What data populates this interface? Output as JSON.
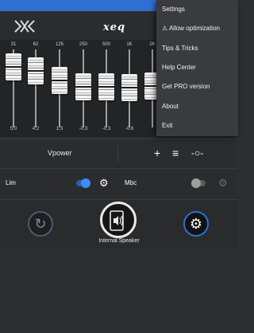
{
  "header": {
    "brand": "xeq"
  },
  "eq": {
    "bands": [
      {
        "freq": "31",
        "gain": "5.0",
        "level": 0.08
      },
      {
        "freq": "62",
        "gain": "4.2",
        "level": 0.15
      },
      {
        "freq": "125",
        "gain": "1.3",
        "level": 0.35
      },
      {
        "freq": "250",
        "gain": "-0.3",
        "level": 0.47
      },
      {
        "freq": "500",
        "gain": "-0.3",
        "level": 0.47
      },
      {
        "freq": "1K",
        "gain": "-0.6",
        "level": 0.49
      },
      {
        "freq": "2K",
        "gain": "",
        "level": 0.45
      }
    ]
  },
  "preset": {
    "name": "Vpower"
  },
  "effects": {
    "lim": {
      "label": "Lim",
      "enabled": true
    },
    "mbc": {
      "label": "Mbc",
      "enabled": false
    }
  },
  "output": {
    "label": "Internal Speaker"
  },
  "menu": {
    "items": [
      {
        "label": "Settings"
      },
      {
        "label": "⚠ Allow optimization"
      },
      {
        "label": "Tips & Tricks"
      },
      {
        "label": "Help Center"
      },
      {
        "label": "Get PRO version"
      },
      {
        "label": "About"
      },
      {
        "label": "Exit"
      }
    ]
  },
  "colors": {
    "accent": "#2f6fcf",
    "background": "#2d2e30",
    "menu": "#3a3b3e"
  }
}
